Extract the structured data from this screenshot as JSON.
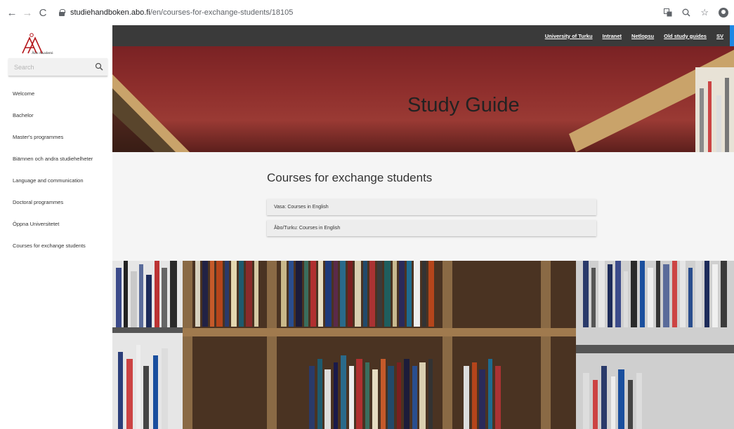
{
  "browser": {
    "url_host": "studiehandboken.abo.fi",
    "url_path": "/en/courses-for-exchange-students/18105"
  },
  "sidebar": {
    "logo_text": "Åbo Akademi",
    "search_placeholder": "Search",
    "items": [
      {
        "label": "Welcome"
      },
      {
        "label": "Bachelor"
      },
      {
        "label": "Master's programmes"
      },
      {
        "label": "Biämnen och andra studiehelheter"
      },
      {
        "label": "Language and communication"
      },
      {
        "label": "Doctoral programmes"
      },
      {
        "label": "Öppna Universitetet"
      },
      {
        "label": "Courses for exchange students"
      }
    ]
  },
  "topnav": {
    "links": [
      {
        "label": "University of Turku"
      },
      {
        "label": "Intranet"
      },
      {
        "label": "Netlopsu"
      },
      {
        "label": "Old study guides"
      },
      {
        "label": "SV"
      }
    ]
  },
  "hero": {
    "title": "Study Guide"
  },
  "content": {
    "title": "Courses for exchange students",
    "rows": [
      {
        "label": "Vasa: Courses in English"
      },
      {
        "label": "Åbo/Turku: Courses in English"
      }
    ]
  },
  "colors": {
    "topbar": "#3a3a3a",
    "hero": "#8e2e2c",
    "logo": "#b5161b",
    "accent": "#1e88e5"
  }
}
